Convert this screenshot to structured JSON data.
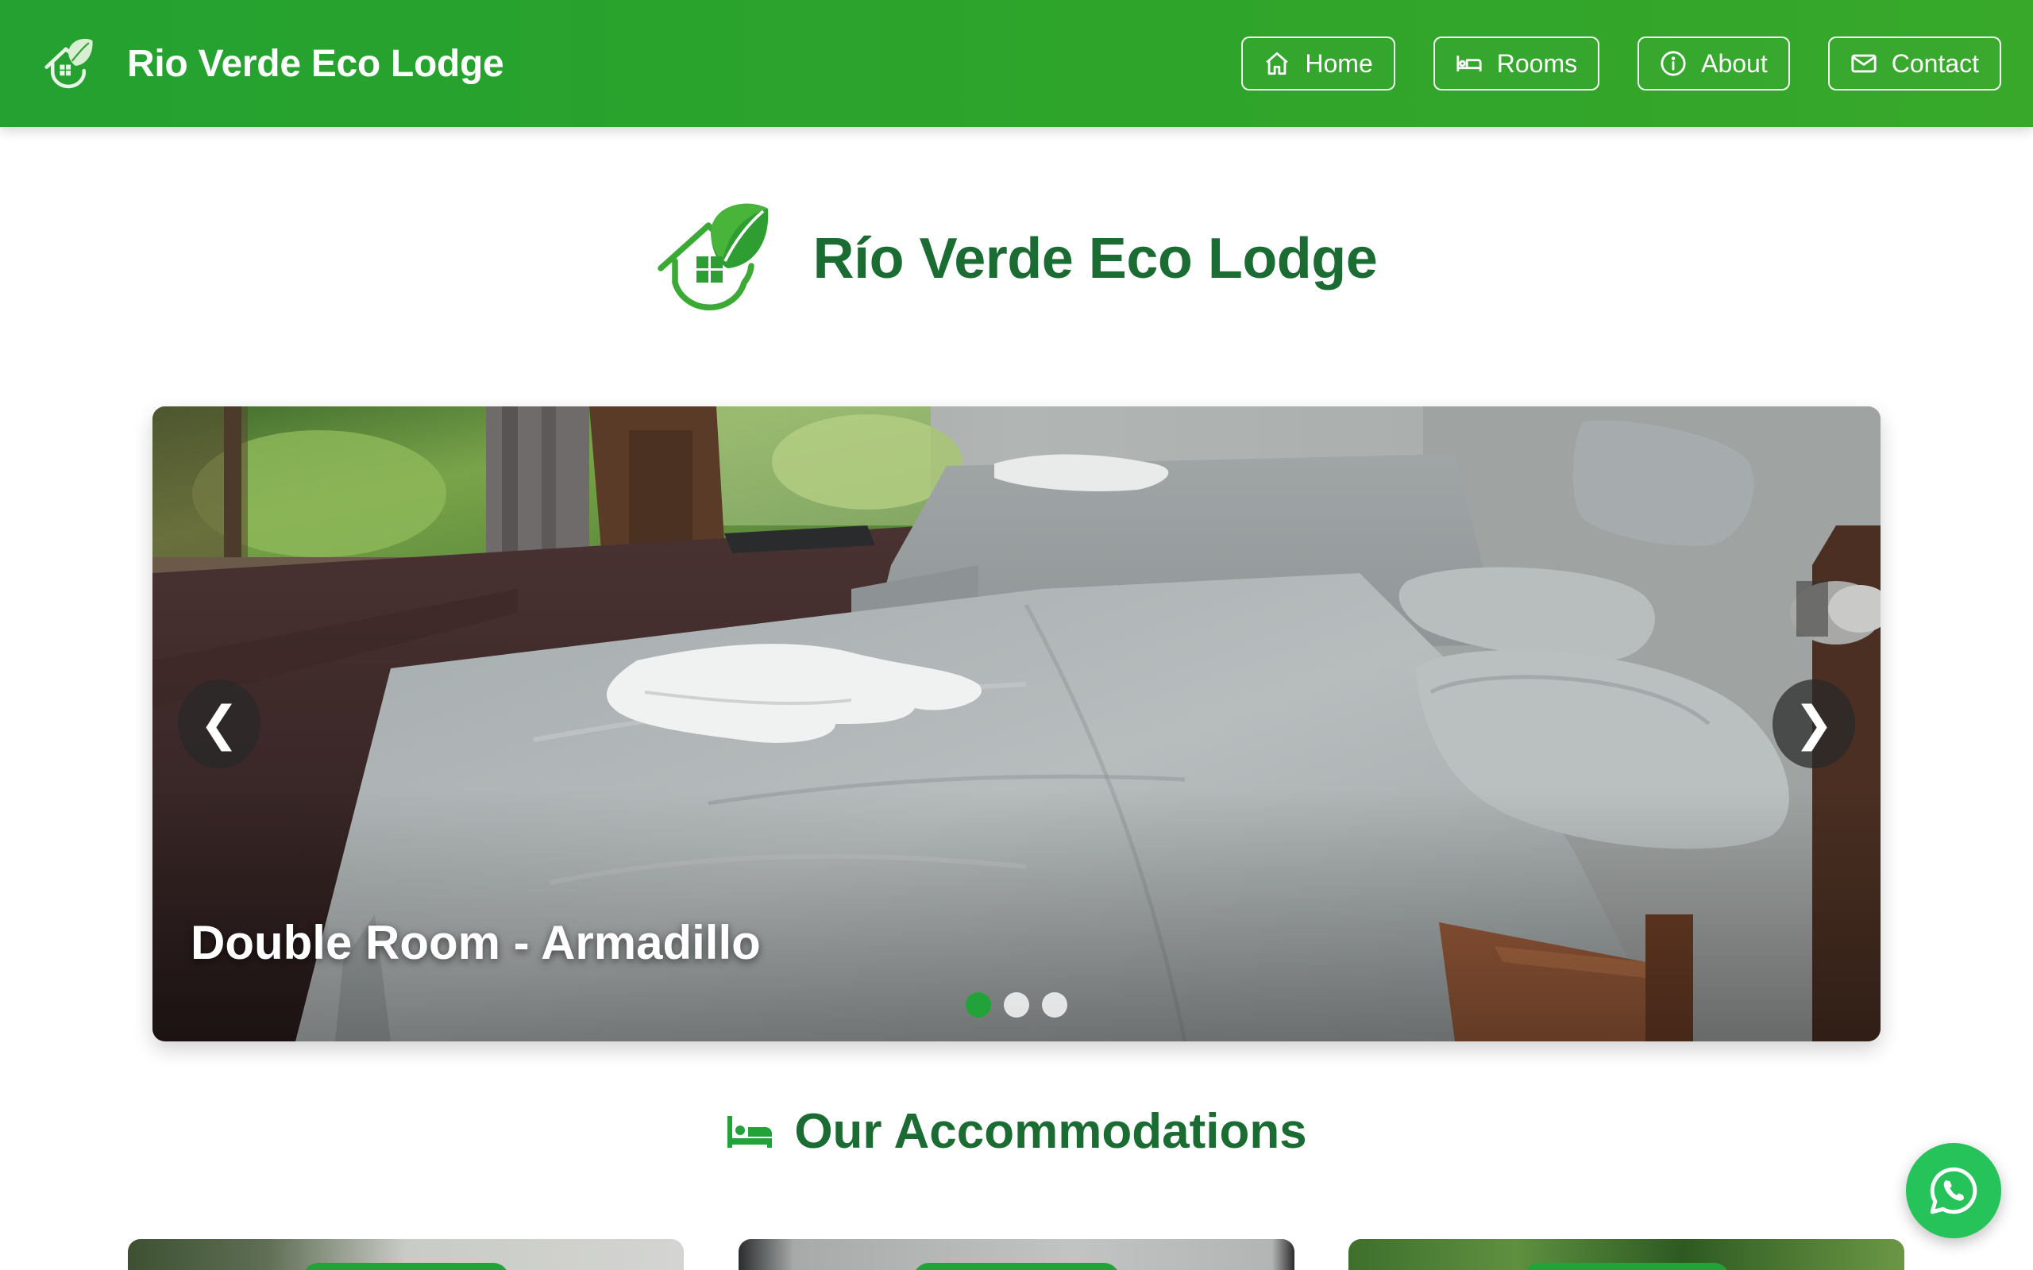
{
  "navbar": {
    "brand": "Rio Verde Eco Lodge",
    "links": [
      {
        "label": "Home",
        "icon": "home-icon"
      },
      {
        "label": "Rooms",
        "icon": "bed-icon"
      },
      {
        "label": "About",
        "icon": "info-icon"
      },
      {
        "label": "Contact",
        "icon": "mail-icon"
      }
    ]
  },
  "hero": {
    "title": "Río Verde Eco Lodge"
  },
  "carousel": {
    "caption": "Double Room - Armadillo",
    "prev_label": "❮",
    "next_label": "❯",
    "slide_count": 3,
    "active_slide": 0
  },
  "accommodations": {
    "title": "Our Accommodations",
    "icon": "bed-icon"
  },
  "floating": {
    "icon": "whatsapp-icon"
  },
  "colors": {
    "nav_green": "#2ea42a",
    "heading_green": "#1b6c32",
    "accent_green": "#22a33a",
    "whatsapp_green": "#25c35a"
  }
}
